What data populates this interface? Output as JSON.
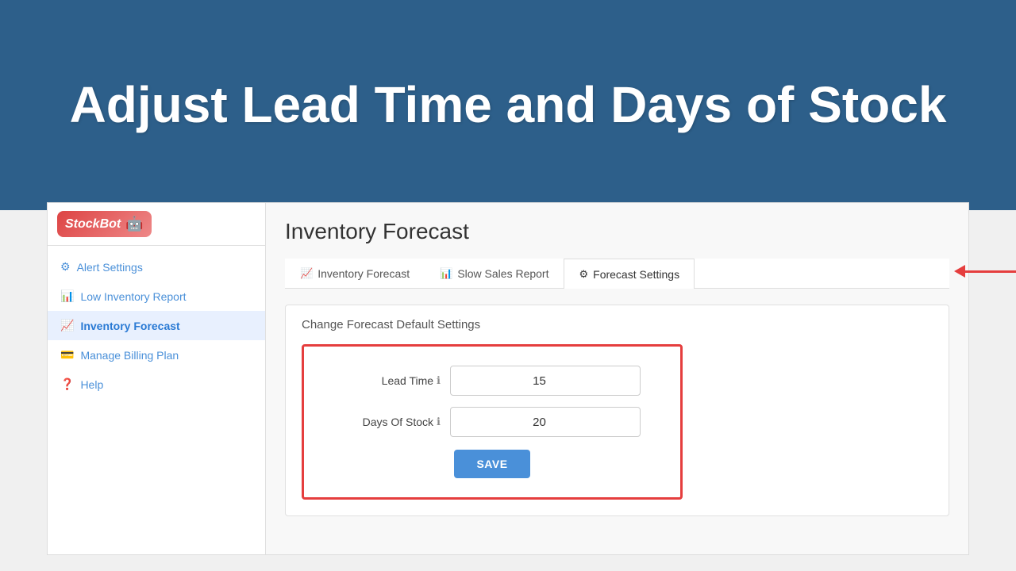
{
  "hero": {
    "title": "Adjust Lead Time and Days of Stock"
  },
  "sidebar": {
    "logo": {
      "text": "StockBot",
      "icon": "🤖"
    },
    "items": [
      {
        "id": "alert-settings",
        "label": "Alert Settings",
        "icon": "⚙",
        "active": false
      },
      {
        "id": "low-inventory-report",
        "label": "Low Inventory Report",
        "icon": "📊",
        "active": false
      },
      {
        "id": "inventory-forecast",
        "label": "Inventory Forecast",
        "icon": "📈",
        "active": true
      },
      {
        "id": "manage-billing-plan",
        "label": "Manage Billing Plan",
        "icon": "💳",
        "active": false
      },
      {
        "id": "help",
        "label": "Help",
        "icon": "❓",
        "active": false
      }
    ]
  },
  "main": {
    "page_title": "Inventory Forecast",
    "tabs": [
      {
        "id": "inventory-forecast-tab",
        "label": "Inventory Forecast",
        "icon": "📈",
        "active": false
      },
      {
        "id": "slow-sales-report-tab",
        "label": "Slow Sales Report",
        "icon": "📊",
        "active": false
      },
      {
        "id": "forecast-settings-tab",
        "label": "Forecast Settings",
        "icon": "⚙",
        "active": true
      }
    ],
    "settings_panel": {
      "title": "Change Forecast Default Settings",
      "lead_time_label": "Lead Time",
      "lead_time_value": "15",
      "days_of_stock_label": "Days Of Stock",
      "days_of_stock_value": "20",
      "save_label": "SAVE"
    }
  }
}
